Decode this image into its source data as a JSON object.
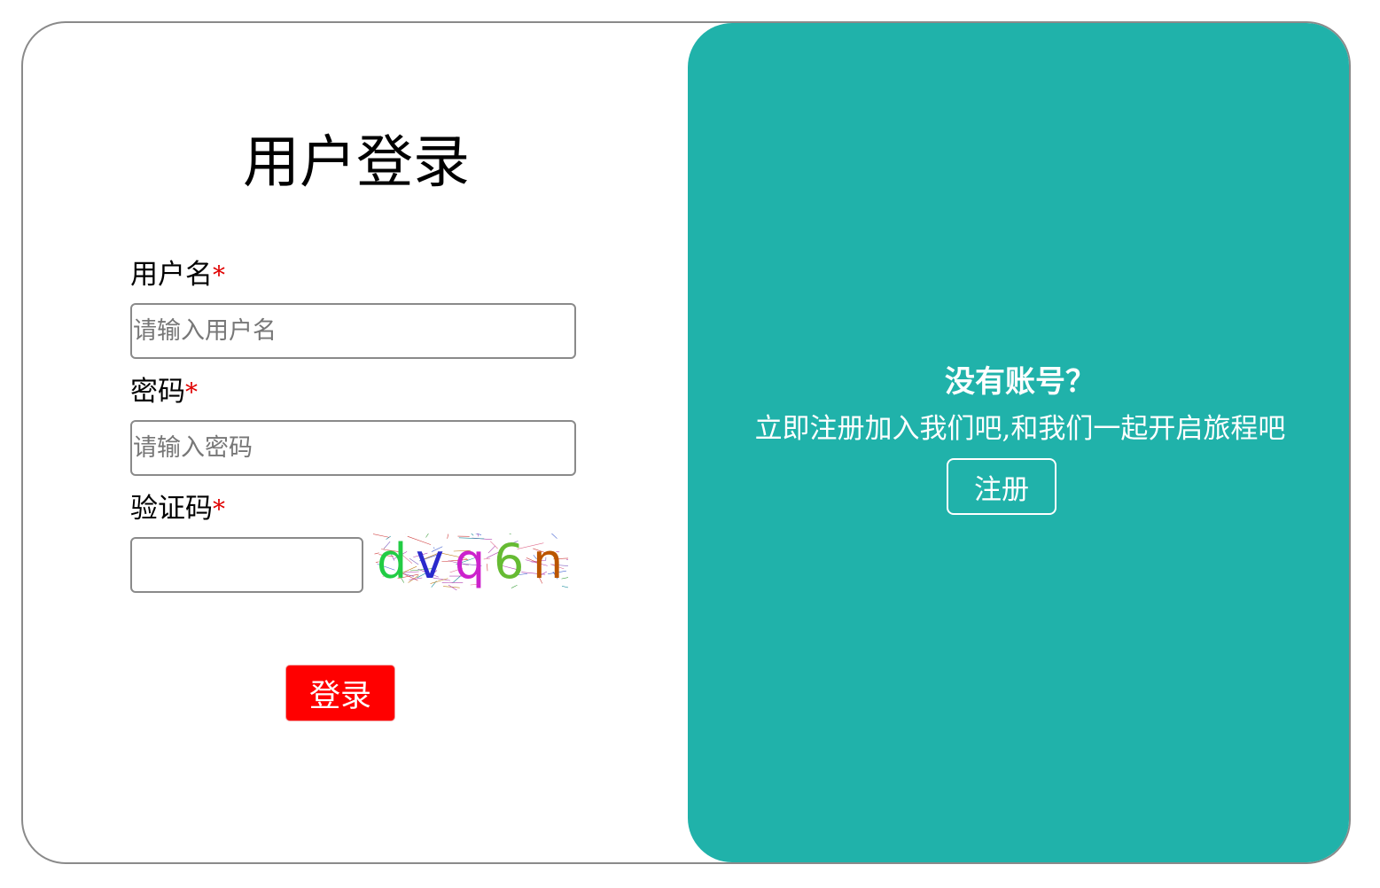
{
  "login": {
    "title": "用户登录",
    "username": {
      "label": "用户名",
      "required_mark": "*",
      "placeholder": "请输入用户名",
      "value": ""
    },
    "password": {
      "label": "密码",
      "required_mark": "*",
      "placeholder": "请输入密码",
      "value": ""
    },
    "captcha": {
      "label": "验证码",
      "required_mark": "*",
      "value": "",
      "image_text": "dvq6n",
      "char_colors": [
        "#22cc44",
        "#2a2acc",
        "#cc22cc",
        "#66bb33",
        "#bb5500"
      ]
    },
    "submit_label": "登录"
  },
  "register": {
    "heading": "没有账号？",
    "subtitle": "立即注册加入我们吧,和我们一起开启旅程吧",
    "button_label": "注册"
  },
  "colors": {
    "panel_background": "#20b2aa",
    "login_button": "#ff0000",
    "required_mark": "#e00000",
    "card_border": "#8a8a8a"
  }
}
